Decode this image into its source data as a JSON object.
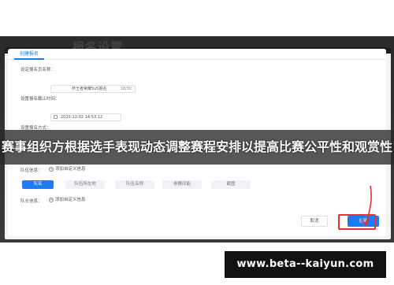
{
  "background": {
    "page_title_partial": "报名设置"
  },
  "modal": {
    "tab_label": "创建报名",
    "fields": {
      "name_label": "设定报名页名称：",
      "name_value": "杯王者荣耀5v5报名",
      "name_counter": "18/30",
      "deadline_label": "设置报名截止时间：",
      "deadline_value": "2020-12-02 14:53:12",
      "form_label": "设置报名方式：",
      "team_info_label": "队伍信息：",
      "add_custom_label": "添加自定义信息",
      "member_info_label": "队长信息：",
      "add_custom_label_2": "添加自定义信息"
    },
    "chips": [
      {
        "label": "队名",
        "active": true
      },
      {
        "label": "队伍所在地",
        "active": false
      },
      {
        "label": "队伍名称",
        "active": false
      },
      {
        "label": "参赛间能",
        "active": false
      },
      {
        "label": "截图",
        "active": false
      }
    ],
    "footer": {
      "cancel_label": "取消",
      "create_label": "创建"
    }
  },
  "caption": {
    "text": "赛事组织方根据选手表现动态调整赛程安排以提高比赛公平性和观赏性"
  },
  "badge": {
    "url": "www.beta--kaiyun.com"
  },
  "colors": {
    "accent": "#1f7af5",
    "highlight": "#e5312f",
    "banner": "#282828"
  }
}
